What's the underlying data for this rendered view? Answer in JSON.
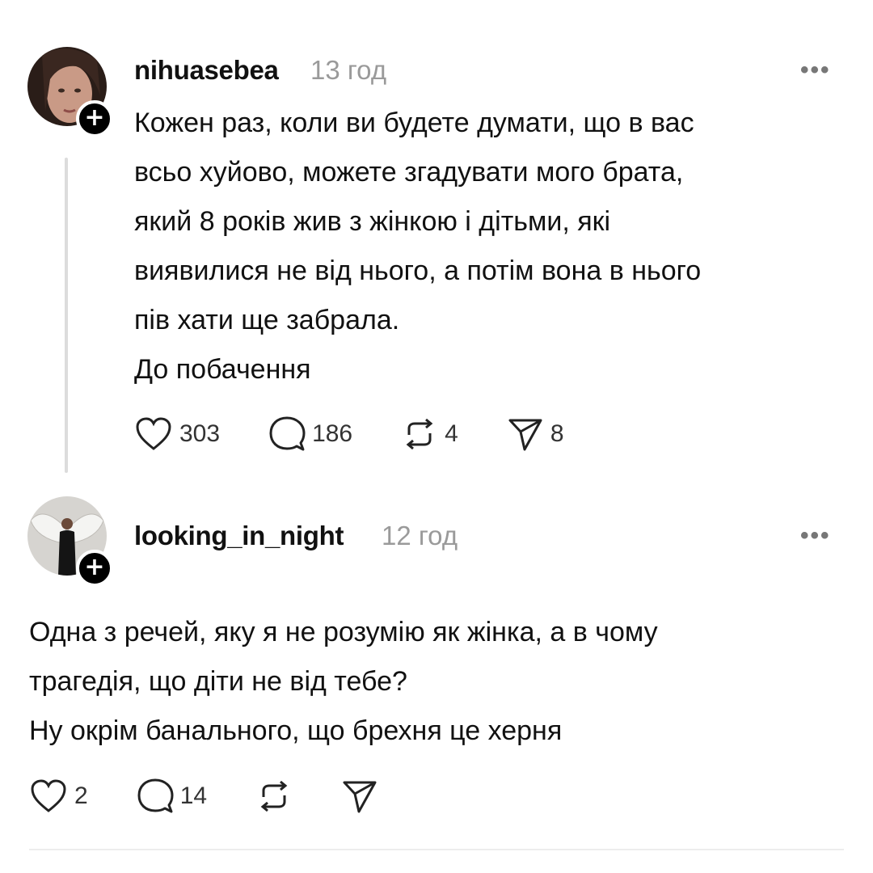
{
  "posts": [
    {
      "username": "nihuasebea",
      "time": "13 год",
      "follow_symbol": "+",
      "more_symbol": "•••",
      "lines": [
        "Кожен раз, коли ви будете думати, що в вас",
        "всьо хуйово, можете згадувати мого брата,",
        "який 8 років жив з жінкою і дітьми, які",
        "виявилися не від нього, а потім вона в нього",
        "пів хати ще забрала.",
        "До побачення"
      ],
      "actions": {
        "likes": "303",
        "comments": "186",
        "reposts": "4",
        "shares": "8"
      }
    },
    {
      "username": "looking_in_night",
      "time": "12 год",
      "follow_symbol": "+",
      "more_symbol": "•••",
      "lines": [
        "Одна з речей, яку я не розумію як жінка, а в чому",
        "трагедія, що діти не від тебе?",
        "Ну окрім банального, що брехня це херня"
      ],
      "actions": {
        "likes": "2",
        "comments": "14"
      }
    }
  ],
  "icons": {
    "like": "heart-icon",
    "comment": "speech-bubble-icon",
    "repost": "repost-icon",
    "share": "paper-plane-icon",
    "follow": "plus-icon",
    "more": "more-options-icon"
  },
  "colors": {
    "text": "#111111",
    "muted": "#9a9a9a",
    "thread_line": "#dcdcdc",
    "background": "#ffffff"
  }
}
